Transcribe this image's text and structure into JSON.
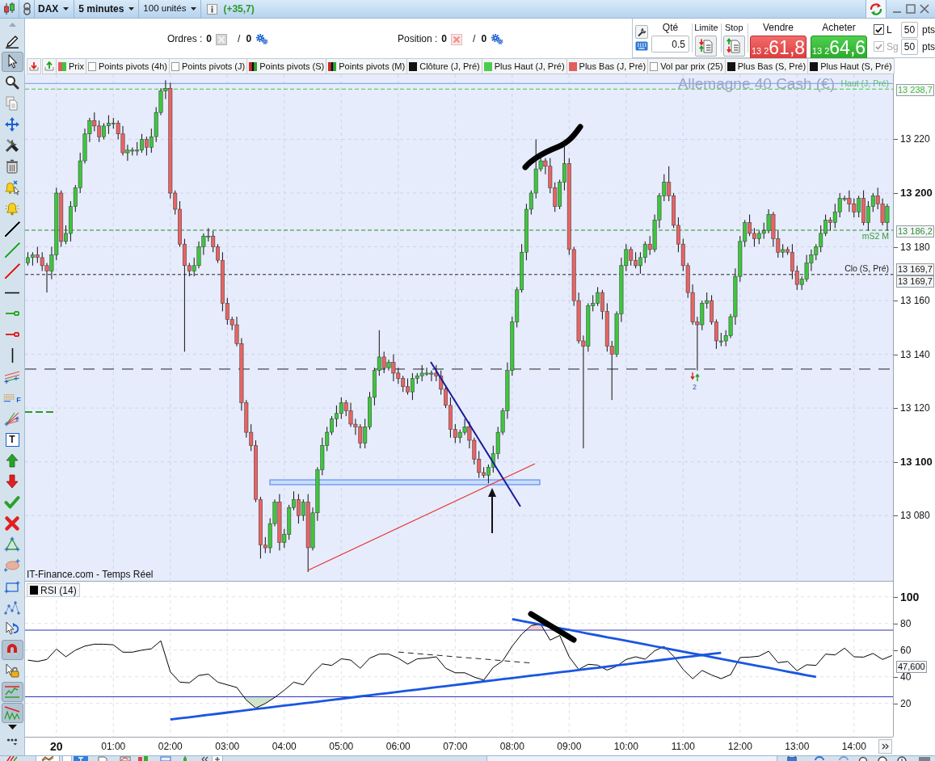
{
  "title_bar": {
    "instrument": "DAX",
    "timeframe": "5 minutes",
    "size": "100 unités",
    "change": "(+35,7)"
  },
  "order_bar": {
    "orders": {
      "label": "Ordres :",
      "count": "0",
      "separator": "/",
      "pending": "0"
    },
    "position": {
      "label": "Position :",
      "count": "0",
      "separator": "/",
      "pending": "0"
    },
    "quantity": {
      "label": "Qté",
      "value": "0.5"
    },
    "limit": {
      "label": "Limite"
    },
    "stop": {
      "label": "Stop"
    },
    "sell": {
      "label": "Vendre",
      "prefix": "13 2",
      "price": "61,8"
    },
    "buy": {
      "label": "Acheter",
      "prefix": "13 2",
      "price": "64,6"
    },
    "distances": [
      {
        "label": "L",
        "checked": true,
        "disabled": false,
        "value": "50",
        "unit": "pts"
      },
      {
        "label": "Sg",
        "checked": true,
        "disabled": true,
        "value": "50",
        "unit": "pts"
      }
    ]
  },
  "legend": [
    {
      "label": "Prix",
      "kind": "candles"
    },
    {
      "label": "Points pivots (4h)",
      "kind": "empty"
    },
    {
      "label": "Points pivots (J)",
      "kind": "empty"
    },
    {
      "label": "Points pivots (S)",
      "kind": "pivots"
    },
    {
      "label": "Points pivots (M)",
      "kind": "pivots"
    },
    {
      "label": "Clôture (J, Pré)",
      "kind": "solid",
      "color": "#111111"
    },
    {
      "label": "Plus Haut (J, Pré)",
      "kind": "solid",
      "color": "#4ccc4c"
    },
    {
      "label": "Plus Bas (J, Pré)",
      "kind": "solid",
      "color": "#e06060"
    },
    {
      "label": "Vol par prix (25)",
      "kind": "empty"
    },
    {
      "label": "Plus Bas (S, Pré)",
      "kind": "solid",
      "color": "#111111"
    },
    {
      "label": "Plus Haut (S, Pré)",
      "kind": "solid",
      "color": "#111111"
    }
  ],
  "drawing_tools": [
    {
      "kind": "pencil",
      "selected": false
    },
    {
      "kind": "pointer",
      "selected": true
    },
    {
      "kind": "zoom",
      "selected": false
    },
    {
      "kind": "copy",
      "selected": false
    },
    {
      "kind": "move",
      "selected": false
    },
    {
      "kind": "tools",
      "selected": false
    },
    {
      "kind": "trash",
      "selected": false
    },
    {
      "kind": "alert",
      "selected": false
    },
    {
      "kind": "bell",
      "selected": false
    },
    {
      "kind": "line",
      "color": "#111111",
      "selected": false
    },
    {
      "kind": "line",
      "color": "#2aaa2a",
      "selected": false
    },
    {
      "kind": "line",
      "color": "#e02424",
      "selected": false
    },
    {
      "kind": "hline",
      "selected": false
    },
    {
      "kind": "ray",
      "color": "#2aaa2a",
      "selected": false
    },
    {
      "kind": "ray",
      "color": "#e02424",
      "selected": false
    },
    {
      "kind": "vline",
      "selected": false
    },
    {
      "kind": "channel",
      "selected": false
    },
    {
      "kind": "fibonacci",
      "glyph": "F",
      "selected": false
    },
    {
      "kind": "fan",
      "selected": false
    },
    {
      "kind": "text",
      "glyph": "T",
      "selected": false
    },
    {
      "kind": "uparrow",
      "selected": false
    },
    {
      "kind": "downarrow",
      "selected": false
    },
    {
      "kind": "check",
      "selected": false
    },
    {
      "kind": "cross",
      "selected": false
    },
    {
      "kind": "triangle",
      "selected": false
    },
    {
      "kind": "ellipse",
      "selected": false
    },
    {
      "kind": "rectangle",
      "selected": false
    },
    {
      "kind": "pattern",
      "selected": false
    },
    {
      "kind": "rotate",
      "selected": false
    },
    {
      "kind": "magnet",
      "selected": true
    },
    {
      "kind": "lock",
      "selected": false
    },
    {
      "kind": "levels",
      "selected": true
    },
    {
      "kind": "trend",
      "selected": true
    }
  ],
  "price_chart": {
    "watermark": "Allemagne 40 Cash (€)",
    "source": "IT-Finance.com - Temps Réel",
    "signal_count": "2",
    "axis_tags": [
      {
        "label": "13 238,7",
        "kind": "high"
      },
      {
        "label": "13 186,2",
        "kind": "pivot"
      },
      {
        "label": "13 169,7",
        "kind": "close"
      },
      {
        "label": "13 169,7",
        "kind": "close"
      }
    ],
    "chart_data": {
      "type": "candlestick",
      "x": [
        -30,
        -25,
        -20,
        -15,
        -10,
        -5,
        0,
        5,
        10,
        15,
        20,
        25,
        30,
        35,
        40,
        45,
        50,
        55,
        60,
        65,
        70,
        75,
        80,
        85,
        90,
        95,
        100,
        105,
        110,
        115,
        120,
        125,
        130,
        135,
        140,
        145,
        150,
        155,
        160,
        165,
        170,
        175,
        180,
        185,
        190,
        195,
        200,
        205,
        210,
        215,
        220,
        225,
        230,
        235,
        240,
        245,
        250,
        255,
        260,
        265,
        270,
        275,
        280,
        285,
        290,
        295,
        300,
        305,
        310,
        315,
        320,
        325,
        330,
        335,
        340,
        345,
        350,
        355,
        360,
        365,
        370,
        375,
        380,
        385,
        390,
        395,
        400,
        405,
        410,
        415,
        420,
        425,
        430,
        435,
        440,
        445,
        450,
        455,
        460,
        465,
        470,
        475,
        480,
        485,
        490,
        495,
        500,
        505,
        510,
        515,
        520,
        525,
        530,
        535,
        540,
        545,
        550,
        555,
        560,
        565,
        570,
        575,
        580,
        585,
        590,
        595,
        600,
        605,
        610,
        615,
        620,
        625,
        630,
        635,
        640,
        645,
        650,
        655,
        660,
        665,
        670,
        675,
        680,
        685,
        690,
        695,
        700,
        705,
        710,
        715,
        720,
        725,
        730,
        735,
        740,
        745,
        750,
        755,
        760,
        765,
        770,
        775,
        780,
        785,
        790,
        795,
        800,
        805,
        810,
        815,
        820,
        825,
        830,
        835,
        840,
        845,
        850,
        855,
        860,
        865,
        870,
        875
      ],
      "ohlc": [
        [
          13174,
          13178,
          13173,
          13176
        ],
        [
          13176,
          13178,
          13173,
          13177
        ],
        [
          13177,
          13180,
          13174,
          13176
        ],
        [
          13176,
          13178,
          13171,
          13173
        ],
        [
          13173,
          13174,
          13163,
          13171
        ],
        [
          13171,
          13180,
          13168,
          13177
        ],
        [
          13177,
          13202,
          13175,
          13200
        ],
        [
          13200,
          13201,
          13180,
          13182
        ],
        [
          13182,
          13188,
          13181,
          13185
        ],
        [
          13185,
          13197,
          13182,
          13195
        ],
        [
          13195,
          13203,
          13193,
          13202
        ],
        [
          13202,
          13215,
          13200,
          13212
        ],
        [
          13212,
          13224,
          13211,
          13222
        ],
        [
          13222,
          13228,
          13219,
          13227
        ],
        [
          13227,
          13230,
          13223,
          13225
        ],
        [
          13225,
          13227,
          13219,
          13221
        ],
        [
          13221,
          13226,
          13220,
          13225
        ],
        [
          13225,
          13229,
          13222,
          13226
        ],
        [
          13226,
          13228,
          13224,
          13226
        ],
        [
          13226,
          13227,
          13220,
          13222
        ],
        [
          13222,
          13225,
          13214,
          13215
        ],
        [
          13215,
          13218,
          13212,
          13216
        ],
        [
          13216,
          13217,
          13214,
          13216
        ],
        [
          13216,
          13219,
          13214,
          13216
        ],
        [
          13216,
          13222,
          13215,
          13220
        ],
        [
          13220,
          13221,
          13214,
          13217
        ],
        [
          13217,
          13224,
          13215,
          13221
        ],
        [
          13221,
          13232,
          13219,
          13230
        ],
        [
          13230,
          13239,
          13229,
          13238
        ],
        [
          13238,
          13242,
          13235,
          13239
        ],
        [
          13239,
          13241,
          13198,
          13200
        ],
        [
          13200,
          13201,
          13192,
          13194
        ],
        [
          13194,
          13197,
          13180,
          13181
        ],
        [
          13181,
          13183,
          13141,
          13173
        ],
        [
          13173,
          13174,
          13169,
          13171
        ],
        [
          13171,
          13176,
          13169,
          13173
        ],
        [
          13173,
          13182,
          13172,
          13180
        ],
        [
          13180,
          13185,
          13177,
          13184
        ],
        [
          13184,
          13187,
          13182,
          13184
        ],
        [
          13184,
          13186,
          13178,
          13180
        ],
        [
          13180,
          13181,
          13174,
          13175
        ],
        [
          13175,
          13178,
          13156,
          13159
        ],
        [
          13159,
          13161,
          13151,
          13153
        ],
        [
          13153,
          13154,
          13149,
          13151
        ],
        [
          13151,
          13154,
          13143,
          13144
        ],
        [
          13144,
          13146,
          13119,
          13122
        ],
        [
          13122,
          13123,
          13109,
          13111
        ],
        [
          13111,
          13114,
          13104,
          13106
        ],
        [
          13106,
          13108,
          13085,
          13086
        ],
        [
          13086,
          13087,
          13064,
          13069
        ],
        [
          13069,
          13072,
          13066,
          13068
        ],
        [
          13068,
          13079,
          13066,
          13077
        ],
        [
          13077,
          13086,
          13076,
          13085
        ],
        [
          13085,
          13088,
          13067,
          13070
        ],
        [
          13070,
          13075,
          13068,
          13073
        ],
        [
          13073,
          13084,
          13071,
          13083
        ],
        [
          13083,
          13089,
          13082,
          13086
        ],
        [
          13086,
          13088,
          13077,
          13080
        ],
        [
          13080,
          13086,
          13078,
          13085
        ],
        [
          13085,
          13088,
          13059,
          13068
        ],
        [
          13068,
          13083,
          13067,
          13081
        ],
        [
          13081,
          13098,
          13078,
          13097
        ],
        [
          13097,
          13109,
          13095,
          13106
        ],
        [
          13106,
          13113,
          13104,
          13111
        ],
        [
          13111,
          13117,
          13110,
          13116
        ],
        [
          13116,
          13121,
          13113,
          13118
        ],
        [
          13118,
          13124,
          13116,
          13122
        ],
        [
          13122,
          13123,
          13117,
          13119
        ],
        [
          13119,
          13122,
          13113,
          13114
        ],
        [
          13114,
          13116,
          13110,
          13113
        ],
        [
          13113,
          13114,
          13105,
          13107
        ],
        [
          13107,
          13116,
          13105,
          13113
        ],
        [
          13113,
          13126,
          13112,
          13124
        ],
        [
          13124,
          13135,
          13121,
          13134
        ],
        [
          13134,
          13149,
          13132,
          13139
        ],
        [
          13139,
          13141,
          13133,
          13135
        ],
        [
          13135,
          13138,
          13134,
          13137
        ],
        [
          13137,
          13140,
          13130,
          13133
        ],
        [
          13133,
          13135,
          13129,
          13131
        ],
        [
          13131,
          13132,
          13126,
          13128
        ],
        [
          13128,
          13131,
          13125,
          13126
        ],
        [
          13126,
          13133,
          13123,
          13131
        ],
        [
          13131,
          13133,
          13129,
          13132
        ],
        [
          13132,
          13136,
          13130,
          13133
        ],
        [
          13133,
          13135,
          13132,
          13133
        ],
        [
          13133,
          13134,
          13130,
          13133
        ],
        [
          13133,
          13136,
          13130,
          13132
        ],
        [
          13132,
          13134,
          13125,
          13127
        ],
        [
          13127,
          13128,
          13120,
          13121
        ],
        [
          13121,
          13124,
          13109,
          13112
        ],
        [
          13112,
          13114,
          13107,
          13109
        ],
        [
          13109,
          13112,
          13107,
          13111
        ],
        [
          13111,
          13116,
          13110,
          13113
        ],
        [
          13113,
          13115,
          13105,
          13108
        ],
        [
          13108,
          13109,
          13099,
          13101
        ],
        [
          13101,
          13104,
          13094,
          13096
        ],
        [
          13096,
          13098,
          13094,
          13095
        ],
        [
          13095,
          13099,
          13092,
          13098
        ],
        [
          13098,
          13106,
          13096,
          13103
        ],
        [
          13103,
          13113,
          13101,
          13111
        ],
        [
          13111,
          13120,
          13110,
          13119
        ],
        [
          13119,
          13137,
          13116,
          13134
        ],
        [
          13134,
          13154,
          13132,
          13152
        ],
        [
          13152,
          13165,
          13150,
          13164
        ],
        [
          13164,
          13181,
          13163,
          13178
        ],
        [
          13178,
          13196,
          13175,
          13194
        ],
        [
          13194,
          13201,
          13192,
          13200
        ],
        [
          13200,
          13220,
          13198,
          13209
        ],
        [
          13209,
          13214,
          13208,
          13212
        ],
        [
          13212,
          13213,
          13207,
          13210
        ],
        [
          13210,
          13213,
          13200,
          13202
        ],
        [
          13202,
          13204,
          13193,
          13195
        ],
        [
          13195,
          13205,
          13194,
          13204
        ],
        [
          13204,
          13219,
          13201,
          13211
        ],
        [
          13211,
          13213,
          13177,
          13179
        ],
        [
          13179,
          13180,
          13158,
          13160
        ],
        [
          13160,
          13163,
          13144,
          13145
        ],
        [
          13145,
          13147,
          13105,
          13143
        ],
        [
          13143,
          13159,
          13141,
          13158
        ],
        [
          13158,
          13162,
          13156,
          13159
        ],
        [
          13159,
          13165,
          13158,
          13163
        ],
        [
          13163,
          13164,
          13153,
          13156
        ],
        [
          13156,
          13159,
          13141,
          13143
        ],
        [
          13143,
          13145,
          13123,
          13140
        ],
        [
          13140,
          13156,
          13139,
          13155
        ],
        [
          13155,
          13176,
          13152,
          13173
        ],
        [
          13173,
          13181,
          13171,
          13179
        ],
        [
          13179,
          13180,
          13173,
          13175
        ],
        [
          13175,
          13178,
          13172,
          13173
        ],
        [
          13173,
          13178,
          13170,
          13176
        ],
        [
          13176,
          13182,
          13174,
          13181
        ],
        [
          13181,
          13184,
          13177,
          13179
        ],
        [
          13179,
          13192,
          13178,
          13190
        ],
        [
          13190,
          13200,
          13187,
          13199
        ],
        [
          13199,
          13207,
          13197,
          13204
        ],
        [
          13204,
          13210,
          13197,
          13199
        ],
        [
          13199,
          13200,
          13187,
          13188
        ],
        [
          13188,
          13191,
          13178,
          13181
        ],
        [
          13181,
          13183,
          13171,
          13173
        ],
        [
          13173,
          13174,
          13161,
          13163
        ],
        [
          13163,
          13166,
          13151,
          13152
        ],
        [
          13152,
          13154,
          13134,
          13151
        ],
        [
          13151,
          13160,
          13149,
          13159
        ],
        [
          13159,
          13163,
          13157,
          13160
        ],
        [
          13160,
          13162,
          13151,
          13152
        ],
        [
          13152,
          13153,
          13142,
          13145
        ],
        [
          13145,
          13148,
          13143,
          13145
        ],
        [
          13145,
          13149,
          13143,
          13147
        ],
        [
          13147,
          13155,
          13146,
          13154
        ],
        [
          13154,
          13172,
          13151,
          13169
        ],
        [
          13169,
          13184,
          13167,
          13182
        ],
        [
          13182,
          13190,
          13180,
          13189
        ],
        [
          13189,
          13192,
          13184,
          13185
        ],
        [
          13185,
          13187,
          13180,
          13183
        ],
        [
          13183,
          13186,
          13181,
          13185
        ],
        [
          13185,
          13189,
          13183,
          13186
        ],
        [
          13186,
          13194,
          13185,
          13192
        ],
        [
          13192,
          13193,
          13180,
          13183
        ],
        [
          13183,
          13186,
          13176,
          13178
        ],
        [
          13178,
          13181,
          13176,
          13179
        ],
        [
          13179,
          13180,
          13177,
          13178
        ],
        [
          13178,
          13181,
          13168,
          13171
        ],
        [
          13171,
          13173,
          13164,
          13166
        ],
        [
          13166,
          13169,
          13164,
          13168
        ],
        [
          13168,
          13177,
          13167,
          13174
        ],
        [
          13174,
          13179,
          13171,
          13177
        ],
        [
          13177,
          13181,
          13175,
          13180
        ],
        [
          13180,
          13188,
          13178,
          13185
        ],
        [
          13185,
          13192,
          13184,
          13190
        ],
        [
          13190,
          13191,
          13186,
          13189
        ],
        [
          13189,
          13196,
          13187,
          13193
        ],
        [
          13193,
          13200,
          13191,
          13198
        ],
        [
          13198,
          13199,
          13197,
          13198
        ],
        [
          13198,
          13201,
          13193,
          13196
        ],
        [
          13196,
          13198,
          13191,
          13193
        ],
        [
          13193,
          13199,
          13191,
          13198
        ],
        [
          13198,
          13201,
          13188,
          13189
        ],
        [
          13189,
          13197,
          13186,
          13195
        ],
        [
          13195,
          13200,
          13193,
          13199
        ],
        [
          13199,
          13202,
          13194,
          13196
        ],
        [
          13196,
          13198,
          13188,
          13189
        ],
        [
          13189,
          13196,
          13186,
          13195
        ]
      ],
      "xlim": [
        -33,
        881
      ],
      "ylim": [
        13055.7,
        13244.2
      ],
      "yticks": [
        {
          "value": 13220,
          "label": "13 220"
        },
        {
          "value": 13200,
          "label": "13 200"
        },
        {
          "value": 13180,
          "label": "13 180"
        },
        {
          "value": 13160,
          "label": "13 160"
        },
        {
          "value": 13140,
          "label": "13 140"
        },
        {
          "value": 13120,
          "label": "13 120"
        },
        {
          "value": 13100,
          "label": "13 100"
        },
        {
          "value": 13080,
          "label": "13 080"
        }
      ],
      "grid": true,
      "ref_lines": [
        {
          "axis": "y",
          "value": 13238.7,
          "label": "Haut (J, Pré)"
        },
        {
          "axis": "y",
          "value": 13186.2,
          "label": "mS2 M"
        },
        {
          "axis": "y",
          "value": 13169.7,
          "label": "Clo (S, Pré)"
        },
        {
          "axis": "y",
          "value": 13134.5
        },
        {
          "axis": "y",
          "value": 13240.8
        }
      ]
    }
  },
  "rsi_panel": {
    "current_value": "47,600",
    "chart_data": {
      "type": "line",
      "x": [
        -30,
        -20,
        -10,
        0,
        10,
        20,
        30,
        40,
        50,
        60,
        70,
        80,
        90,
        100,
        110,
        120,
        130,
        140,
        150,
        160,
        170,
        180,
        190,
        200,
        210,
        220,
        230,
        240,
        250,
        260,
        270,
        280,
        290,
        300,
        310,
        320,
        330,
        340,
        350,
        360,
        370,
        380,
        390,
        400,
        410,
        420,
        430,
        440,
        450,
        460,
        470,
        480,
        490,
        500,
        510,
        520,
        530,
        540,
        550,
        560,
        570,
        580,
        590,
        600,
        610,
        620,
        630,
        640,
        650,
        660,
        670,
        680,
        690,
        700,
        710,
        720,
        730,
        740,
        750,
        760,
        770,
        780,
        790,
        800,
        810,
        820,
        830,
        840,
        850,
        860,
        870,
        880
      ],
      "series": [
        {
          "name": "RSI (14)",
          "color": "#000000",
          "values": [
            52.5,
            51.5,
            53,
            60.8,
            55,
            60,
            63,
            64.5,
            64.5,
            64,
            58.5,
            58.5,
            60,
            61,
            67,
            43.7,
            36,
            35.5,
            41,
            42,
            36,
            34,
            32,
            22.5,
            16.5,
            20,
            24.5,
            30,
            36,
            34,
            42.7,
            49.7,
            48.5,
            53.5,
            52.5,
            46.4,
            54,
            57,
            57,
            54,
            49.5,
            53.5,
            54,
            55,
            46.4,
            43,
            43,
            39.8,
            37.5,
            47,
            52,
            63,
            72,
            78.5,
            79.5,
            67.5,
            71,
            55,
            45.5,
            49.4,
            48.8,
            45,
            48,
            53,
            55,
            53.2,
            59.5,
            62.8,
            55.4,
            45.5,
            38.5,
            44.8,
            41.3,
            38.6,
            41.6,
            54.5,
            54.8,
            55.5,
            59.2,
            50.6,
            51.5,
            44.6,
            49,
            48.6,
            57,
            56.4,
            61.5,
            55,
            54.8,
            57.5,
            53,
            56
          ]
        },
        {
          "color": "#222222",
          "line_style": "dashed",
          "values": [
            null,
            null,
            null,
            null,
            null,
            null,
            null,
            null,
            null,
            null,
            null,
            null,
            null,
            null,
            null,
            null,
            null,
            null,
            null,
            null,
            null,
            null,
            null,
            null,
            null,
            null,
            null,
            null,
            null,
            null,
            null,
            null,
            null,
            null,
            null,
            null,
            null,
            null,
            null,
            58.6,
            58.0,
            57.4,
            56.8,
            56.2,
            55.6,
            55.0,
            54.4,
            53.9,
            53.3,
            52.7,
            52.1,
            51.5,
            50.9,
            50.4,
            null,
            null,
            null,
            null,
            null,
            null,
            null,
            null,
            null,
            null,
            null,
            null,
            null,
            null,
            null,
            null,
            null,
            null,
            null,
            null,
            null,
            null,
            null,
            null,
            null,
            null,
            null,
            null,
            null,
            null,
            null,
            null,
            null,
            null,
            null,
            null,
            null,
            null
          ]
        },
        {
          "color": "#1a56e0",
          "values": [
            null,
            null,
            null,
            null,
            null,
            null,
            null,
            null,
            null,
            null,
            null,
            null,
            null,
            null,
            null,
            8.0,
            8.9,
            9.7,
            10.6,
            11.5,
            12.3,
            13.2,
            14.0,
            14.9,
            15.8,
            16.6,
            17.5,
            18.4,
            19.2,
            20.1,
            20.9,
            21.8,
            22.7,
            23.5,
            24.4,
            25.3,
            26.1,
            27.0,
            27.8,
            28.7,
            29.6,
            30.4,
            31.3,
            32.2,
            33.0,
            33.9,
            34.7,
            35.6,
            36.5,
            37.3,
            38.2,
            39.1,
            39.9,
            40.8,
            41.6,
            42.5,
            43.4,
            44.2,
            45.1,
            46.0,
            46.8,
            47.7,
            48.5,
            49.4,
            50.3,
            51.1,
            52.0,
            52.9,
            53.7,
            54.6,
            55.4,
            56.3,
            57.2,
            58.0,
            null,
            null,
            null,
            null,
            null,
            null,
            null,
            null,
            null,
            null,
            null,
            null,
            null,
            null,
            null,
            null,
            null,
            null
          ]
        },
        {
          "color": "#1a56e0",
          "values": [
            null,
            null,
            null,
            null,
            null,
            null,
            null,
            null,
            null,
            null,
            null,
            null,
            null,
            null,
            null,
            null,
            null,
            null,
            null,
            null,
            null,
            null,
            null,
            null,
            null,
            null,
            null,
            null,
            null,
            null,
            null,
            null,
            null,
            null,
            null,
            null,
            null,
            null,
            null,
            null,
            null,
            null,
            null,
            null,
            null,
            null,
            null,
            null,
            null,
            null,
            null,
            83.3,
            81.9,
            80.6,
            79.2,
            77.9,
            76.5,
            75.2,
            73.8,
            72.4,
            71.1,
            69.7,
            68.4,
            67.0,
            65.7,
            64.3,
            62.9,
            61.6,
            60.2,
            58.9,
            57.5,
            56.2,
            54.8,
            53.4,
            52.1,
            50.7,
            49.4,
            48.0,
            46.7,
            45.3,
            43.9,
            42.6,
            41.2,
            39.9,
            null,
            null,
            null,
            null,
            null,
            null,
            null,
            null
          ]
        }
      ],
      "xlim": [
        -33,
        881
      ],
      "ylim": [
        -5,
        112
      ],
      "xticks": [
        {
          "value": 60,
          "label": "01:00"
        },
        {
          "value": 120,
          "label": "02:00"
        },
        {
          "value": 180,
          "label": "03:00"
        },
        {
          "value": 240,
          "label": "04:00"
        },
        {
          "value": 300,
          "label": "05:00"
        },
        {
          "value": 360,
          "label": "06:00"
        },
        {
          "value": 420,
          "label": "07:00"
        },
        {
          "value": 480,
          "label": "08:00"
        },
        {
          "value": 540,
          "label": "09:00"
        },
        {
          "value": 600,
          "label": "10:00"
        },
        {
          "value": 660,
          "label": "11:00"
        },
        {
          "value": 720,
          "label": "12:00"
        },
        {
          "value": 780,
          "label": "13:00"
        },
        {
          "value": 840,
          "label": "14:00"
        }
      ],
      "yticks": [
        100,
        80,
        60,
        40,
        20
      ],
      "grid": true,
      "ref_lines": [
        {
          "axis": "y",
          "value": 75
        },
        {
          "axis": "y",
          "value": 25
        }
      ]
    }
  },
  "time_axis": {
    "date_label": "20"
  }
}
